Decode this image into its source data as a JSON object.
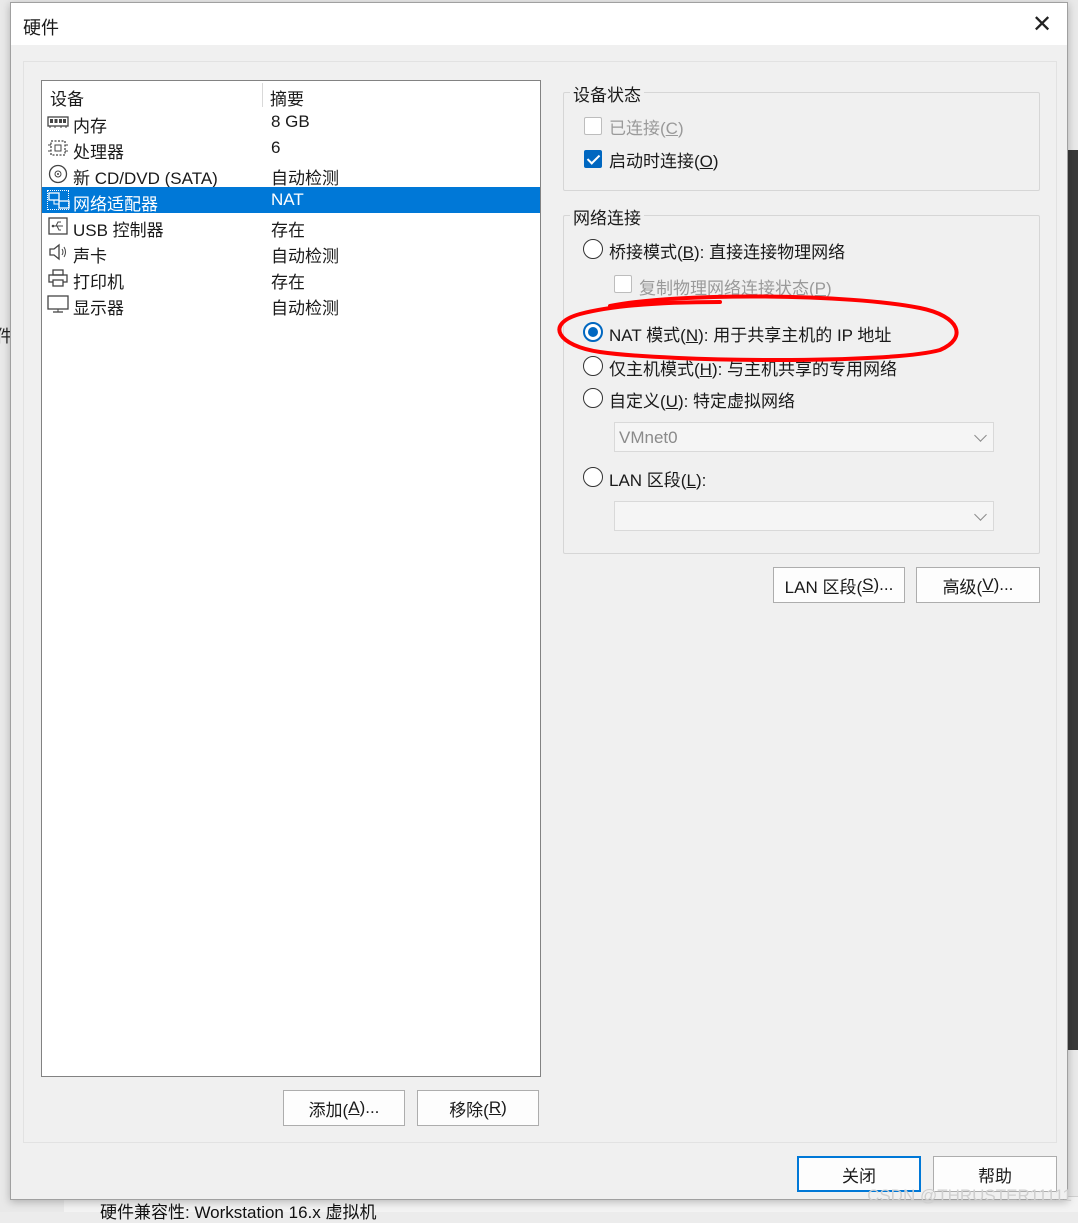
{
  "window": {
    "title": "硬件",
    "close_glyph": "✕"
  },
  "device_list": {
    "headers": {
      "device": "设备",
      "summary": "摘要"
    },
    "items": [
      {
        "name": "内存",
        "summary": "8 GB",
        "icon": "memory-icon"
      },
      {
        "name": "处理器",
        "summary": "6",
        "icon": "processor-icon"
      },
      {
        "name": "新 CD/DVD (SATA)",
        "summary": "自动检测",
        "icon": "cd-dvd-icon"
      },
      {
        "name": "网络适配器",
        "summary": "NAT",
        "icon": "network-adapter-icon",
        "selected": true
      },
      {
        "name": "USB 控制器",
        "summary": "存在",
        "icon": "usb-icon"
      },
      {
        "name": "声卡",
        "summary": "自动检测",
        "icon": "speaker-icon"
      },
      {
        "name": "打印机",
        "summary": "存在",
        "icon": "printer-icon"
      },
      {
        "name": "显示器",
        "summary": "自动检测",
        "icon": "display-icon"
      }
    ]
  },
  "list_buttons": {
    "add": {
      "text": "添加(",
      "key": "A",
      "tail": ")..."
    },
    "remove": {
      "text": "移除(",
      "key": "R",
      "tail": ")"
    }
  },
  "device_status": {
    "title": "设备状态",
    "connected": {
      "text": "已连接(",
      "key": "C",
      "tail": ")",
      "checked": false,
      "enabled": false
    },
    "connect_at_power_on": {
      "text": "启动时连接(",
      "key": "O",
      "tail": ")",
      "checked": true,
      "enabled": true
    }
  },
  "network_connection": {
    "title": "网络连接",
    "bridged": {
      "text": "桥接模式(",
      "key": "B",
      "tail": "): 直接连接物理网络"
    },
    "replicate": {
      "text": "复制物理网络连接状态(",
      "key": "P",
      "tail": ")"
    },
    "nat": {
      "text": "NAT 模式(",
      "key": "N",
      "tail": "): 用于共享主机的 IP 地址"
    },
    "host_only": {
      "text": "仅主机模式(",
      "key": "H",
      "tail": "): 与主机共享的专用网络"
    },
    "custom": {
      "text": "自定义(",
      "key": "U",
      "tail": "): 特定虚拟网络"
    },
    "custom_select": "VMnet0",
    "lan_segment": {
      "text": "LAN 区段(",
      "key": "L",
      "tail": "):"
    },
    "lan_select": "",
    "selected": "nat"
  },
  "side_buttons": {
    "lan_segments": {
      "text": "LAN 区段(",
      "key": "S",
      "tail": ")..."
    },
    "advanced": {
      "text": "高级(",
      "key": "V",
      "tail": ")..."
    }
  },
  "footer": {
    "close": "关闭",
    "help": "帮助"
  },
  "background": {
    "fragment": "件",
    "bottom_text": "硬件兼容性: Workstation 16.x 虚拟机"
  },
  "watermark": "CSDN @THRUSTER11111",
  "colors": {
    "accent": "#0078d7",
    "annotation": "#ff0000"
  }
}
